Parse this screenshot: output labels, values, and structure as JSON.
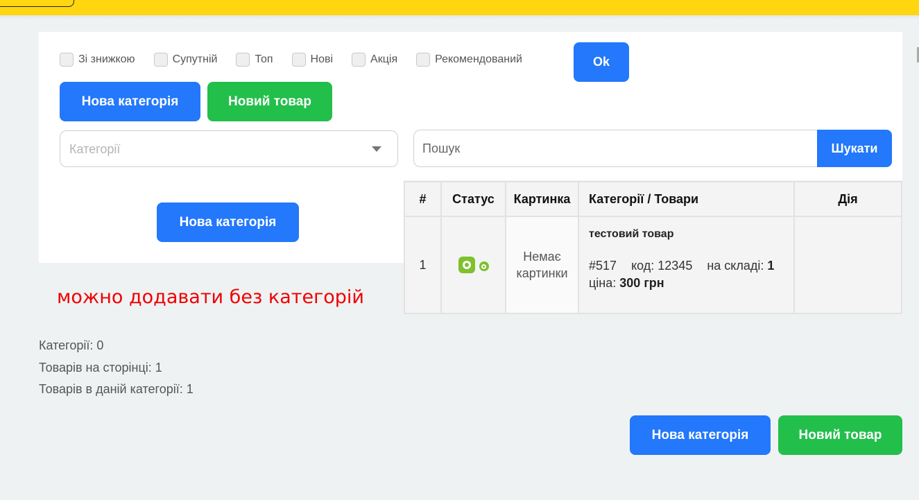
{
  "filters": [
    {
      "label": "Зі знижкою",
      "checked": false
    },
    {
      "label": "Супутній",
      "checked": false
    },
    {
      "label": "Топ",
      "checked": false
    },
    {
      "label": "Нові",
      "checked": false
    },
    {
      "label": "Акція",
      "checked": false
    },
    {
      "label": "Рекомендований",
      "checked": false
    }
  ],
  "ok_label": "Ok",
  "buttons": {
    "new_category": "Нова категорія",
    "new_product": "Новий товар",
    "search": "Шукати"
  },
  "category_select": {
    "placeholder": "Категорії"
  },
  "search": {
    "placeholder": "Пошук",
    "value": ""
  },
  "note": "можно додавати без категорій",
  "stats": {
    "categories": "Категорії: 0",
    "products_on_page": "Товарів на сторінці: 1",
    "products_in_category": "Товарів в даній категорії: 1"
  },
  "table": {
    "headers": [
      "#",
      "Статус",
      "Картинка",
      "Категорії / Товари",
      "Дія"
    ],
    "rows": [
      {
        "num": "1",
        "status_icons": [
          "active-toggle-icon",
          "visible-dot-icon"
        ],
        "image": "Немає картинки",
        "name": "тестовий товар",
        "id": "#517",
        "code_label": "код:",
        "code": "12345",
        "stock_label": "на складі:",
        "stock": "1",
        "price_label": "ціна:",
        "price": "300 грн",
        "action": ""
      }
    ]
  },
  "colors": {
    "topbar": "#ffd60f",
    "primary": "#2378fb",
    "success": "#22bf4b",
    "status_green": "#7ec12d",
    "note_red": "#ef0000"
  }
}
